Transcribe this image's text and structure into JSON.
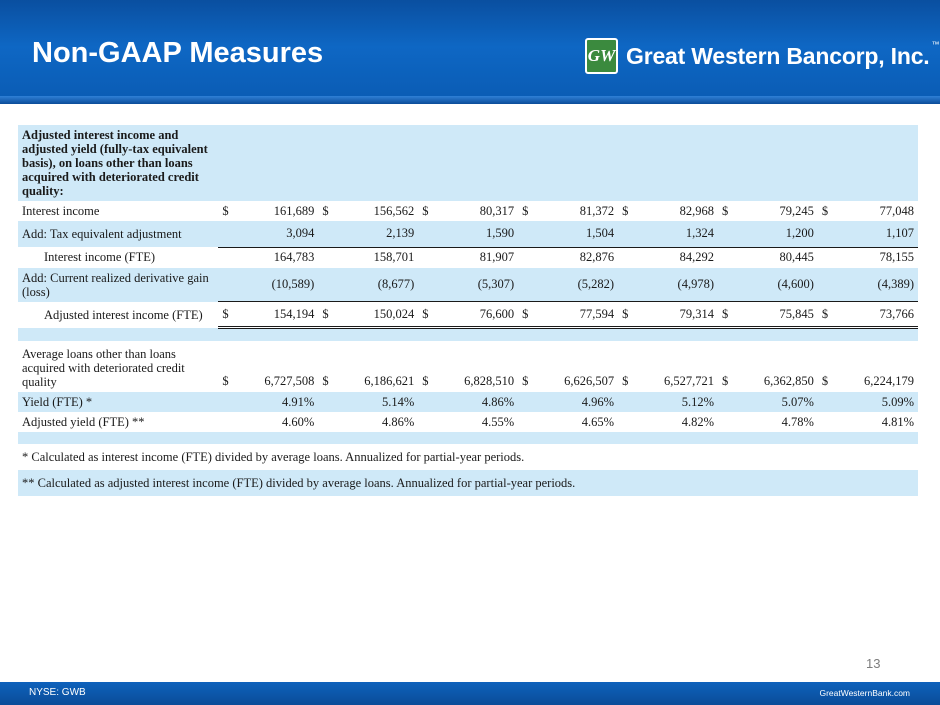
{
  "header": {
    "title": "Non-GAAP Measures",
    "logo_mark": "GW",
    "logo_text": "Great Western Bancorp, Inc.",
    "logo_tm": "™"
  },
  "table": {
    "heading": "Adjusted interest income and adjusted yield (fully-tax equivalent basis), on loans other than loans acquired with deteriorated credit quality:",
    "currency": "$",
    "rows": {
      "interest_income": {
        "label": "Interest income",
        "values": [
          "161,689",
          "156,562",
          "80,317",
          "81,372",
          "82,968",
          "79,245",
          "77,048"
        ]
      },
      "tax_adj": {
        "label": "Add: Tax equivalent adjustment",
        "values": [
          "3,094",
          "2,139",
          "1,590",
          "1,504",
          "1,324",
          "1,200",
          "1,107"
        ]
      },
      "interest_fte": {
        "label": "Interest income (FTE)",
        "values": [
          "164,783",
          "158,701",
          "81,907",
          "82,876",
          "84,292",
          "80,445",
          "78,155"
        ]
      },
      "deriv": {
        "label": "Add: Current realized derivative gain (loss)",
        "values": [
          "(10,589)",
          "(8,677)",
          "(5,307)",
          "(5,282)",
          "(4,978)",
          "(4,600)",
          "(4,389)"
        ]
      },
      "adj_fte": {
        "label": "Adjusted interest income (FTE)",
        "values": [
          "154,194",
          "150,024",
          "76,600",
          "77,594",
          "79,314",
          "75,845",
          "73,766"
        ]
      },
      "avg_loans": {
        "label": "Average loans other than loans acquired with deteriorated credit quality",
        "values": [
          "6,727,508",
          "6,186,621",
          "6,828,510",
          "6,626,507",
          "6,527,721",
          "6,362,850",
          "6,224,179"
        ]
      },
      "yield": {
        "label": "Yield (FTE) *",
        "values": [
          "4.91%",
          "5.14%",
          "4.86%",
          "4.96%",
          "5.12%",
          "5.07%",
          "5.09%"
        ]
      },
      "adj_yield": {
        "label": "Adjusted yield (FTE) **",
        "values": [
          "4.60%",
          "4.86%",
          "4.55%",
          "4.65%",
          "4.82%",
          "4.78%",
          "4.81%"
        ]
      }
    },
    "notes": [
      "* Calculated as interest income (FTE) divided by average loans. Annualized for partial-year periods.",
      "** Calculated as adjusted interest income (FTE) divided by average loans. Annualized for partial-year periods."
    ]
  },
  "page_number": "13",
  "footer": {
    "ticker": "NYSE: GWB",
    "website": "GreatWesternBank.com"
  },
  "colors": {
    "header_blue": "#0e67c4",
    "band_blue": "#cfe9f8",
    "logo_green": "#3b8a3e"
  }
}
